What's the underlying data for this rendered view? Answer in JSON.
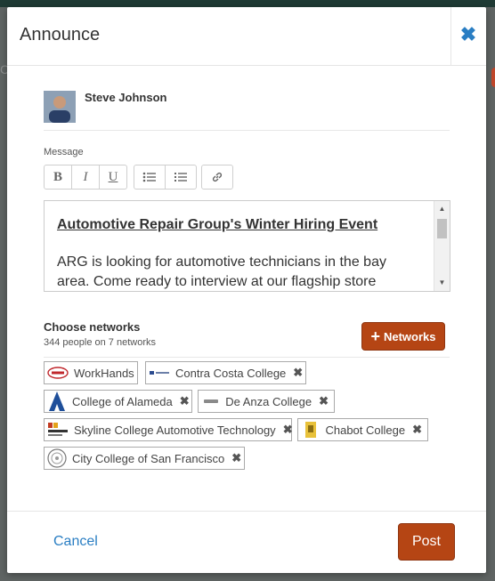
{
  "modal": {
    "title": "Announce",
    "close_icon": "close-icon"
  },
  "user": {
    "name": "Steve Johnson"
  },
  "message": {
    "label": "Message",
    "toolbar": [
      "bold",
      "italic",
      "underline",
      "bulleted-list",
      "numbered-list",
      "link"
    ],
    "toolbar_glyphs": {
      "bold": "B",
      "italic": "I",
      "underline": "U"
    },
    "content_title": "Automotive Repair Group's Winter Hiring Event ",
    "content_body": "ARG is looking for automotive technicians in the bay area. Come ready to interview at our flagship store"
  },
  "networks": {
    "title": "Choose networks",
    "count": "344 people on 7 networks",
    "add_button": "Networks",
    "items": [
      {
        "label": "WorkHands",
        "removable": false
      },
      {
        "label": "Contra Costa College",
        "removable": true
      },
      {
        "label": "College of Alameda",
        "removable": true
      },
      {
        "label": "De Anza College",
        "removable": true
      },
      {
        "label": "Skyline College Automotive Technology",
        "removable": true
      },
      {
        "label": "Chabot College",
        "removable": true
      },
      {
        "label": "City College of San Francisco",
        "removable": true
      }
    ],
    "remove_glyph": "✖"
  },
  "footer": {
    "cancel": "Cancel",
    "post": "Post"
  },
  "colors": {
    "accent": "#b54514",
    "link": "#2a7ec3"
  }
}
